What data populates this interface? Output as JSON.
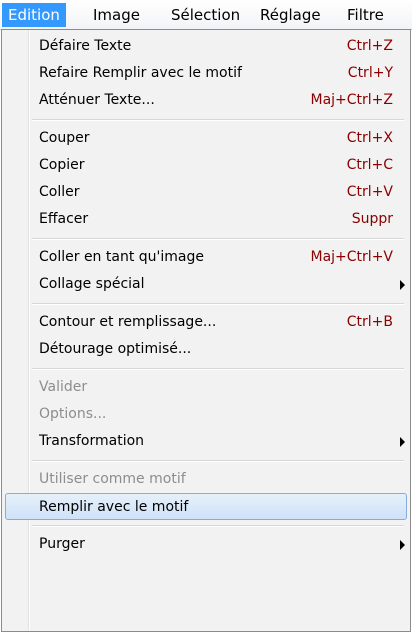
{
  "menubar": {
    "items": [
      "Edition",
      "Image",
      "Sélection",
      "Réglage",
      "Filtre"
    ]
  },
  "menu": {
    "items": [
      {
        "label": "Défaire Texte",
        "shortcut": "Ctrl+Z"
      },
      {
        "label": "Refaire Remplir avec le motif",
        "shortcut": "Ctrl+Y"
      },
      {
        "label": "Atténuer Texte...",
        "shortcut": "Maj+Ctrl+Z"
      },
      {
        "label": "Couper",
        "shortcut": "Ctrl+X"
      },
      {
        "label": "Copier",
        "shortcut": "Ctrl+C"
      },
      {
        "label": "Coller",
        "shortcut": "Ctrl+V"
      },
      {
        "label": "Effacer",
        "shortcut": "Suppr"
      },
      {
        "label": "Coller en tant qu'image",
        "shortcut": "Maj+Ctrl+V"
      },
      {
        "label": "Collage spécial",
        "shortcut": ""
      },
      {
        "label": "Contour et remplissage...",
        "shortcut": "Ctrl+B"
      },
      {
        "label": "Détourage optimisé...",
        "shortcut": ""
      },
      {
        "label": "Valider",
        "shortcut": "",
        "disabled": true
      },
      {
        "label": "Options...",
        "shortcut": "",
        "disabled": true
      },
      {
        "label": "Transformation",
        "shortcut": ""
      },
      {
        "label": "Utiliser comme motif",
        "shortcut": "",
        "disabled": true
      },
      {
        "label": "Remplir avec le motif",
        "shortcut": "",
        "highlighted": true
      },
      {
        "label": "Purger",
        "shortcut": ""
      }
    ]
  },
  "colors": {
    "active_menu": "#3399ff",
    "shortcut_text": "#8b0000",
    "disabled_text": "#8d8d8d",
    "highlight_border": "#84acdd"
  }
}
